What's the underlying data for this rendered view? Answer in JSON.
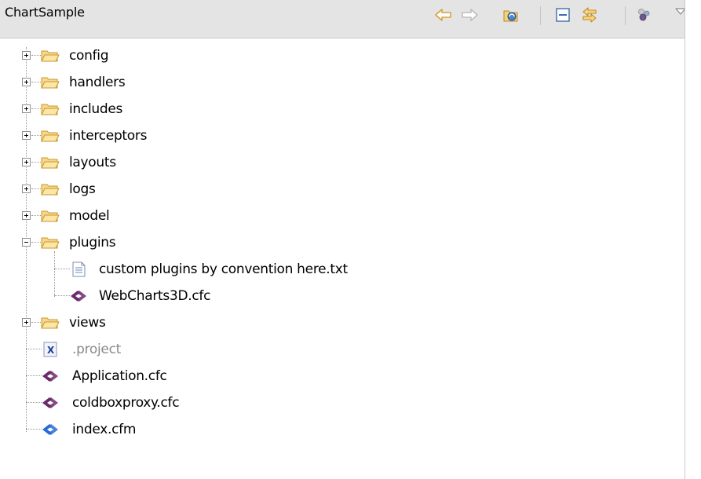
{
  "panel": {
    "title": "ChartSample"
  },
  "toolbar": {
    "icons": [
      "back-arrow-icon",
      "forward-arrow-icon",
      "refresh-project-icon",
      "collapse-all-icon",
      "link-with-editor-icon",
      "object-icon",
      "view-menu-icon"
    ]
  },
  "tree": {
    "folders": [
      {
        "label": "config",
        "expanded": false
      },
      {
        "label": "handlers",
        "expanded": false
      },
      {
        "label": "includes",
        "expanded": false
      },
      {
        "label": "interceptors",
        "expanded": false
      },
      {
        "label": "layouts",
        "expanded": false
      },
      {
        "label": "logs",
        "expanded": false
      },
      {
        "label": "model",
        "expanded": false
      },
      {
        "label": "plugins",
        "expanded": true
      }
    ],
    "plugin_children": [
      {
        "label": "custom plugins by convention here.txt",
        "icon": "text-file-icon"
      },
      {
        "label": "WebCharts3D.cfc",
        "icon": "cfc-file-icon"
      }
    ],
    "views": {
      "label": "views",
      "expanded": false
    },
    "files": [
      {
        "label": ".project",
        "icon": "xml-file-icon",
        "dim": true
      },
      {
        "label": "Application.cfc",
        "icon": "cfc-file-icon"
      },
      {
        "label": "coldboxproxy.cfc",
        "icon": "cfc-file-icon"
      },
      {
        "label": "index.cfm",
        "icon": "cfm-file-icon"
      }
    ]
  },
  "colors": {
    "header_bg": "#e4e4e4",
    "folder_fill": "#f7d78a",
    "folder_stroke": "#c79a2a",
    "cfc_icon": "#6a2a6a",
    "cfm_icon": "#2a6ad8",
    "dim_text": "#8a8a8a"
  }
}
